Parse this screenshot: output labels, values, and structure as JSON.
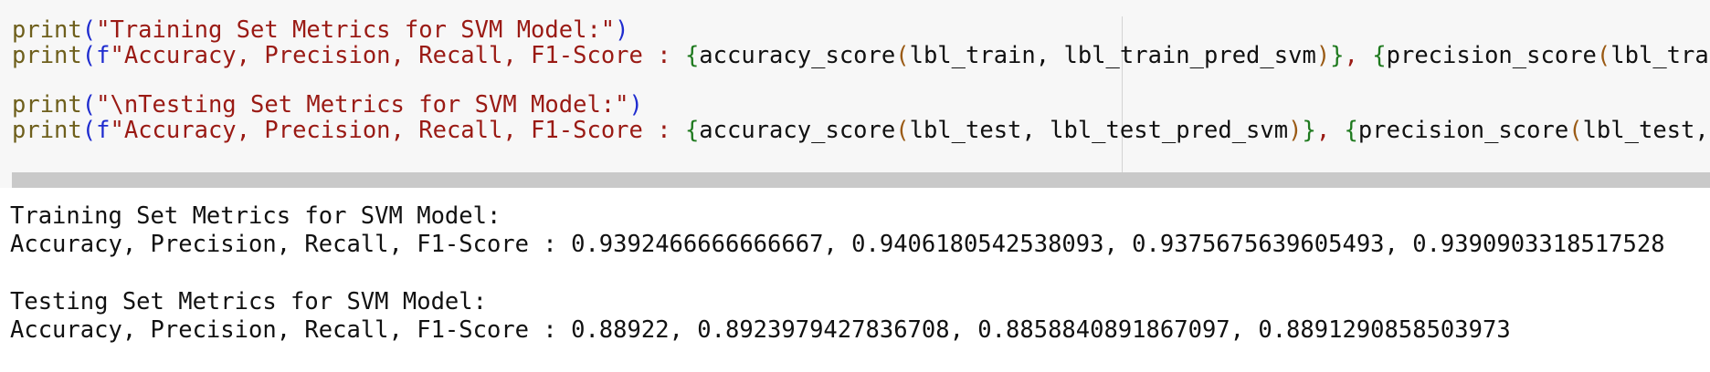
{
  "code": {
    "line1": {
      "fn": "print",
      "open": "(",
      "string": "\"Training Set Metrics for SVM Model:\"",
      "close": ")"
    },
    "line2": {
      "fn": "print",
      "open": "(",
      "fprefix": "f",
      "string": "\"Accuracy, Precision, Recall, F1-Score : ",
      "brace_open": "{",
      "call1_name": "accuracy_score",
      "call1_open": "(",
      "call1_args": "lbl_train, lbl_train_pred_svm",
      "call1_close": ")",
      "brace_close": "}",
      "sep": ", ",
      "brace_open2": "{",
      "call2_name": "precision_score",
      "call2_open": "(",
      "call2_args": "lbl_train"
    },
    "line4": {
      "fn": "print",
      "open": "(",
      "string": "\"\\nTesting Set Metrics for SVM Model:\"",
      "close": ")"
    },
    "line5": {
      "fn": "print",
      "open": "(",
      "fprefix": "f",
      "string": "\"Accuracy, Precision, Recall, F1-Score : ",
      "brace_open": "{",
      "call1_name": "accuracy_score",
      "call1_open": "(",
      "call1_args": "lbl_test, lbl_test_pred_svm",
      "call1_close": ")",
      "brace_close": "}",
      "sep": ", ",
      "brace_open2": "{",
      "call2_name": "precision_score",
      "call2_open": "(",
      "call2_args": "lbl_test, l"
    }
  },
  "output": {
    "line1": "Training Set Metrics for SVM Model:",
    "line2": "Accuracy, Precision, Recall, F1-Score : 0.9392466666666667, 0.9406180542538093, 0.9375675639605493, 0.9390903318517528",
    "line4": "Testing Set Metrics for SVM Model:",
    "line5": "Accuracy, Precision, Recall, F1-Score : 0.88922, 0.8923979427836708, 0.8858840891867097, 0.8891290858503973"
  }
}
